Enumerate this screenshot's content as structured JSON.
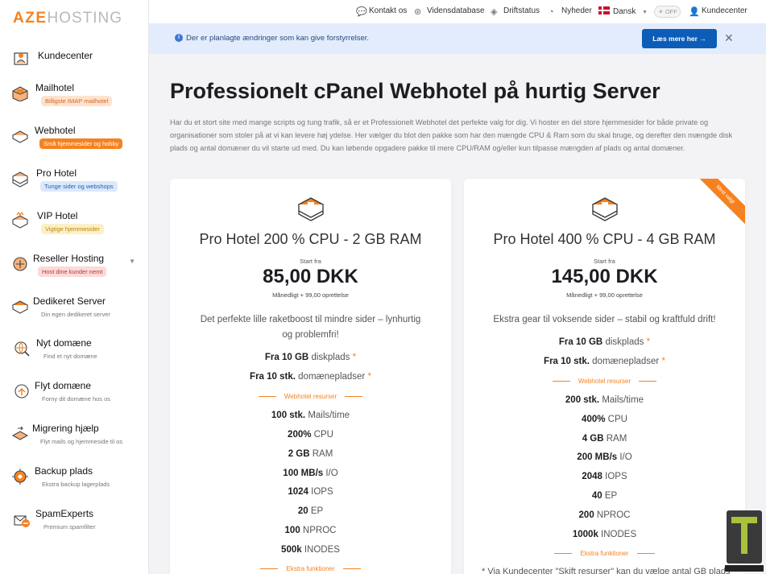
{
  "brand": {
    "logo_bold": "AZE",
    "logo_thin": "HOSTING"
  },
  "topbar": {
    "contact": "Kontakt os",
    "knowledgebase": "Vidensdatabase",
    "status": "Driftstatus",
    "news": "Nyheder",
    "language": "Dansk",
    "dark_toggle": "OFF",
    "client_area": "Kundecenter"
  },
  "notice": {
    "text": "Der er planlagte ændringer som kan give forstyrrelser.",
    "button": "Læs mere her"
  },
  "sidebar": {
    "items": [
      {
        "label": "Kundecenter",
        "badge": ""
      },
      {
        "label": "Mailhotel",
        "badge": "Billigste IMAP mailhotel"
      },
      {
        "label": "Webhotel",
        "badge": "Små hjemmesider og hobby"
      },
      {
        "label": "Pro Hotel",
        "badge": "Tunge sider og webshops"
      },
      {
        "label": "VIP Hotel",
        "badge": "Vigtige hjemmesider"
      },
      {
        "label": "Reseller Hosting",
        "badge": "Host dine kunder nemt"
      },
      {
        "label": "Dedikeret Server",
        "badge": "Din egen dedikeret server"
      },
      {
        "label": "Nyt domæne",
        "badge": "Find et nyt domæne"
      },
      {
        "label": "Flyt domæne",
        "badge": "Forny dit domæne hos os"
      },
      {
        "label": "Migrering hjælp",
        "badge": "Flyt mails og hjemmeside til os"
      },
      {
        "label": "Backup plads",
        "badge": "Ekstra backup lagerplads"
      },
      {
        "label": "SpamExperts",
        "badge": "Premium spamfilter"
      }
    ]
  },
  "main": {
    "title": "Professionelt cPanel Webhotel på hurtig Server",
    "description": "Har du et stort site med mange scripts og tung trafik, så er et Professionelt Webhotel det perfekte valg for dig. Vi hoster en del store hjemmesider for både private og organisationer som stoler på at vi kan levere høj ydelse. Her vælger du blot den pakke som har den mængde CPU & Ram som du skal bruge, og derefter den mængde disk plads og antal domæner du vil starte ud med. Du kan løbende opgadere pakke til mere CPU/RAM og/eller kun tilpasse mængden af plads og antal domæner."
  },
  "plans": [
    {
      "name": "Pro Hotel 200 % CPU - 2 GB RAM",
      "start_label": "Start fra",
      "price": "85,00 DKK",
      "price_note": "Månedligt + 99,00 oprettelse",
      "tagline": "Det perfekte lille raketboost til mindre sider – lynhurtig og problemfri!",
      "ribbon": "",
      "base": [
        {
          "value": "Fra 10 GB",
          "label": "diskplads"
        },
        {
          "value": "Fra 10 stk.",
          "label": "domænepladser"
        }
      ],
      "resources_title": "Webhotel resurser",
      "resources": [
        {
          "value": "100 stk.",
          "label": "Mails/time"
        },
        {
          "value": "200%",
          "label": "CPU"
        },
        {
          "value": "2 GB",
          "label": "RAM"
        },
        {
          "value": "100 MB/s",
          "label": "I/O"
        },
        {
          "value": "1024",
          "label": "IOPS"
        },
        {
          "value": "20",
          "label": "EP"
        },
        {
          "value": "100",
          "label": "NPROC"
        },
        {
          "value": "500k",
          "label": "INODES"
        }
      ],
      "extra_title": "Ekstra funktioner",
      "footnote": ""
    },
    {
      "name": "Pro Hotel 400 % CPU - 4 GB RAM",
      "start_label": "Start fra",
      "price": "145,00 DKK",
      "price_note": "Månedligt + 99,00 oprettelse",
      "tagline": "Ekstra gear til voksende sider – stabil og kraftfuld drift!",
      "ribbon": "Mest valgt",
      "base": [
        {
          "value": "Fra 10 GB",
          "label": "diskplads"
        },
        {
          "value": "Fra 10 stk.",
          "label": "domænepladser"
        }
      ],
      "resources_title": "Webhotel resurser",
      "resources": [
        {
          "value": "200 stk.",
          "label": "Mails/time"
        },
        {
          "value": "400%",
          "label": "CPU"
        },
        {
          "value": "4 GB",
          "label": "RAM"
        },
        {
          "value": "200 MB/s",
          "label": "I/O"
        },
        {
          "value": "2048",
          "label": "IOPS"
        },
        {
          "value": "40",
          "label": "EP"
        },
        {
          "value": "200",
          "label": "NPROC"
        },
        {
          "value": "1000k",
          "label": "INODES"
        }
      ],
      "extra_title": "Ekstra funktioner",
      "footnote": "* Via Kundecenter \"Skift resurser\" kan du vælge antal GB plads"
    }
  ],
  "colors": {
    "accent": "#f58220",
    "primary": "#0d5db8",
    "notice_bg": "#e2ecfc"
  }
}
